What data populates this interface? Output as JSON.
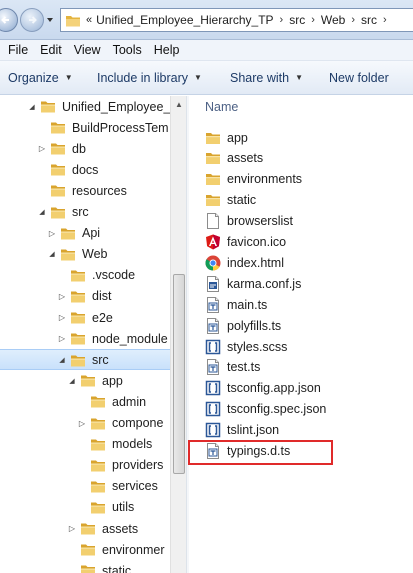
{
  "address_bar": {
    "lead": "«",
    "crumbs": [
      "Unified_Employee_Hierarchy_TP",
      "src",
      "Web",
      "src"
    ],
    "separator": "›"
  },
  "menu": [
    "File",
    "Edit",
    "View",
    "Tools",
    "Help"
  ],
  "toolbar": {
    "organize": "Organize",
    "include": "Include in library",
    "share": "Share with",
    "newfolder": "New folder"
  },
  "tree": [
    {
      "label": "Unified_Employee_",
      "expander": "expanded",
      "indent": 0
    },
    {
      "label": "BuildProcessTem",
      "expander": "none",
      "indent": 1
    },
    {
      "label": "db",
      "expander": "collapsed",
      "indent": 1
    },
    {
      "label": "docs",
      "expander": "none",
      "indent": 1
    },
    {
      "label": "resources",
      "expander": "none",
      "indent": 1
    },
    {
      "label": "src",
      "expander": "expanded",
      "indent": 1
    },
    {
      "label": "Api",
      "expander": "collapsed",
      "indent": 2
    },
    {
      "label": "Web",
      "expander": "expanded",
      "indent": 2
    },
    {
      "label": ".vscode",
      "expander": "none",
      "indent": 3
    },
    {
      "label": "dist",
      "expander": "collapsed",
      "indent": 3
    },
    {
      "label": "e2e",
      "expander": "collapsed",
      "indent": 3
    },
    {
      "label": "node_module",
      "expander": "collapsed",
      "indent": 3
    },
    {
      "label": "src",
      "expander": "expanded",
      "indent": 3,
      "selected": true
    },
    {
      "label": "app",
      "expander": "expanded",
      "indent": 4
    },
    {
      "label": "admin",
      "expander": "none",
      "indent": 5
    },
    {
      "label": "compone",
      "expander": "collapsed",
      "indent": 5
    },
    {
      "label": "models",
      "expander": "none",
      "indent": 5
    },
    {
      "label": "providers",
      "expander": "none",
      "indent": 5
    },
    {
      "label": "services",
      "expander": "none",
      "indent": 5
    },
    {
      "label": "utils",
      "expander": "none",
      "indent": 5
    },
    {
      "label": "assets",
      "expander": "collapsed",
      "indent": 4
    },
    {
      "label": "environmer",
      "expander": "none",
      "indent": 4
    },
    {
      "label": "static",
      "expander": "none",
      "indent": 4
    }
  ],
  "content": {
    "column_header": "Name",
    "files": [
      {
        "name": "app",
        "icon": "folder-icon"
      },
      {
        "name": "assets",
        "icon": "folder-icon"
      },
      {
        "name": "environments",
        "icon": "folder-icon"
      },
      {
        "name": "static",
        "icon": "folder-icon"
      },
      {
        "name": "browserslist",
        "icon": "blank-file-icon"
      },
      {
        "name": "favicon.ico",
        "icon": "angular-icon"
      },
      {
        "name": "index.html",
        "icon": "chrome-icon"
      },
      {
        "name": "karma.conf.js",
        "icon": "js-file-icon"
      },
      {
        "name": "main.ts",
        "icon": "ts-file-icon"
      },
      {
        "name": "polyfills.ts",
        "icon": "ts-file-icon"
      },
      {
        "name": "styles.scss",
        "icon": "bracket-file-icon"
      },
      {
        "name": "test.ts",
        "icon": "ts-file-icon"
      },
      {
        "name": "tsconfig.app.json",
        "icon": "bracket-file-icon"
      },
      {
        "name": "tsconfig.spec.json",
        "icon": "bracket-file-icon"
      },
      {
        "name": "tslint.json",
        "icon": "bracket-file-icon"
      },
      {
        "name": "typings.d.ts",
        "icon": "ts-file-icon",
        "highlighted": true
      }
    ]
  },
  "colors": {
    "highlight": "#e02a2a",
    "selection": "#cce4fc",
    "folder": "#e9c46a"
  }
}
